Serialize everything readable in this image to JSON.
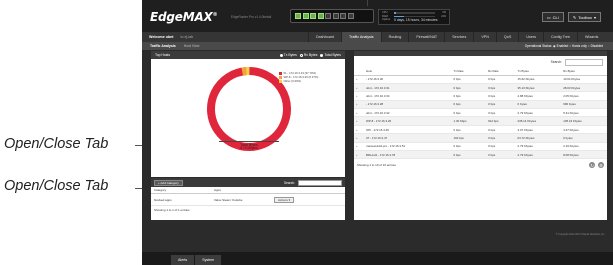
{
  "callouts": {
    "label1": "Open/Close Tab",
    "label2": "Open/Close Tab"
  },
  "header": {
    "logo": "EdgeMAX",
    "firmware": "EdgeRouter Pro v1.4.0beta4",
    "stats": [
      {
        "label": "CPU",
        "percent": 6,
        "value": "6%"
      },
      {
        "label": "RAM",
        "percent": 24,
        "value": "24%"
      },
      {
        "label": "Uptime",
        "percent": 0,
        "value": ""
      }
    ],
    "uptime_text": "0 days, 15 hours, 34 minutes",
    "cli_label": "CLI",
    "toolbox_label": "Toolbox",
    "ports": [
      true,
      true,
      true,
      true,
      false,
      false,
      false,
      false
    ]
  },
  "nav": {
    "welcome": "Welcome ubnt",
    "host": "to ej-lab",
    "tabs": [
      "Dashboard",
      "Traffic Analysis",
      "Routing",
      "Firewall/NAT",
      "Services",
      "VPN",
      "QoS",
      "Users",
      "Config Tree",
      "Wizards"
    ],
    "active_tab": "Traffic Analysis"
  },
  "subbar": {
    "title": "Traffic Analysis",
    "subtitle": "Host View",
    "operational_status": "Operational Status: ◉ Enabled ○ Hosts only ○ Disabled"
  },
  "top_hosts": {
    "title": "Top Hosts",
    "options": [
      "Tx Bytes",
      "Rx Bytes",
      "Total Bytes"
    ],
    "legend": [
      {
        "label": "01 - 172.16.3.43 (97.70%)",
        "color": "#e0263b"
      },
      {
        "label": "WP-8 - 172.16.3.26 (0.37%)",
        "color": "#f2a33a"
      },
      {
        "label": "Other (0.30%)",
        "color": "#f6d34a"
      }
    ],
    "total_label": "Total Bytes",
    "total_value": "6.74 Mbytes"
  },
  "chart_data": {
    "type": "pie",
    "title": "Top Hosts",
    "categories": [
      "01 - 172.16.3.43",
      "WP-8 - 172.16.3.26",
      "Other"
    ],
    "values": [
      97.7,
      0.37,
      0.3
    ]
  },
  "categories_panel": {
    "add_label": "+ Add Category",
    "search_label": "Search:",
    "columns": [
      "Category",
      "Apps",
      ""
    ],
    "rows": [
      {
        "category": "blocked apps",
        "apps": "Valve Steam Youtube",
        "action": "Actions ▾"
      }
    ],
    "showing": "Showing 1 to 1 of 1 entries"
  },
  "hosts_table": {
    "search_label": "Search:",
    "columns": [
      "",
      "Host",
      "Tx Rate",
      "Rx Rate",
      "Tx Bytes",
      "Rx Bytes"
    ],
    "rows": [
      {
        "host": "- 172.16.3.30",
        "tx_rate": "0 bps",
        "rx_rate": "0 bps",
        "tx_bytes": "15.62 Kbytes",
        "rx_bytes": "10.64 Kbytes"
      },
      {
        "host": "ubnt - 172.16.3.31",
        "tx_rate": "0 bps",
        "rx_rate": "0 bps",
        "tx_bytes": "35.13 Kbytes",
        "rx_bytes": "28.03 Kbytes"
      },
      {
        "host": "ubnt - 172.16.3.34",
        "tx_rate": "0 bps",
        "rx_rate": "0 bps",
        "tx_bytes": "2.88 Kbytes",
        "rx_bytes": "2.05 Kbytes"
      },
      {
        "host": "- 172.16.3.28",
        "tx_rate": "0 bps",
        "rx_rate": "0 bps",
        "tx_bytes": "0 bytes",
        "rx_bytes": "690 bytes"
      },
      {
        "host": "ubnt - 172.16.3.32",
        "tx_rate": "0 bps",
        "rx_rate": "0 bps",
        "tx_bytes": "2.79 Kbytes",
        "rx_bytes": "5.31 Kbytes"
      },
      {
        "host": "WP-8 - 172.16.3.26",
        "tx_rate": "1.30 Kbps",
        "rx_rate": "912 bps",
        "tx_bytes": "235.14 Kbytes",
        "rx_bytes": "135.24 Kbytes"
      },
      {
        "host": "OPI - 172.16.3.45",
        "tx_rate": "0 bps",
        "rx_rate": "0 bps",
        "tx_bytes": "3.07 Kbytes",
        "rx_bytes": "4.37 Kbytes"
      },
      {
        "host": "3T - 172.16.3.47",
        "tx_rate": "192 bps",
        "rx_rate": "0 bps",
        "tx_bytes": "64.72 Kbytes",
        "rx_bytes": "0 bytes"
      },
      {
        "host": "manual-dut2-pro - 172.16.3.51",
        "tx_rate": "0 bps",
        "rx_rate": "0 bps",
        "tx_bytes": "2.79 Kbytes",
        "rx_bytes": "2.19 Kbytes"
      },
      {
        "host": "BRL/ed1 - 172.16.3.78",
        "tx_rate": "0 bps",
        "rx_rate": "0 bps",
        "tx_bytes": "2.79 Kbytes",
        "rx_bytes": "8.08 Kbytes"
      }
    ],
    "showing": "Showing 1 to 10 of 10 entries"
  },
  "footer": {
    "copyright": "© Copyright 2012-2013 Ubiquiti Networks, Inc.",
    "tabs": [
      "Alerts",
      "System"
    ]
  }
}
